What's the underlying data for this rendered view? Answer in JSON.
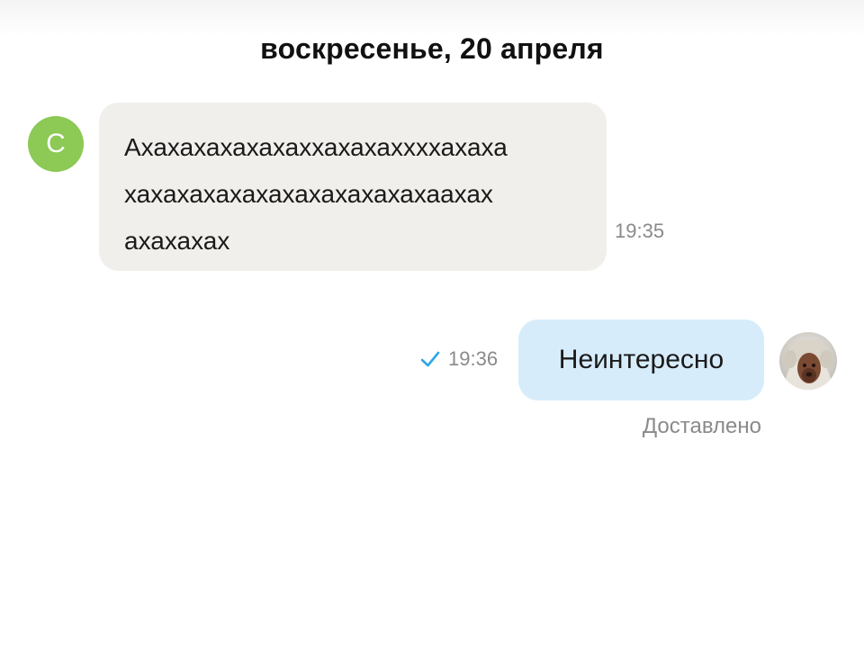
{
  "date_header": "воскресенье, 20 апреля",
  "incoming": {
    "avatar_letter": "С",
    "avatar_color": "#8cc955",
    "bubble_color": "#f1efeb",
    "text": "Ахахахахахахаххахахаххххахаха\nхахахахахахахахахахахахаахах\nахахахах",
    "time": "19:35"
  },
  "outgoing": {
    "text": "Неинтересно",
    "time": "19:36",
    "status_icon": "check-icon",
    "status_icon_color": "#2ea6e8",
    "bubble_color": "#d7ecfb",
    "avatar_icon": "user-photo-avatar",
    "delivery_status": "Доставлено"
  }
}
